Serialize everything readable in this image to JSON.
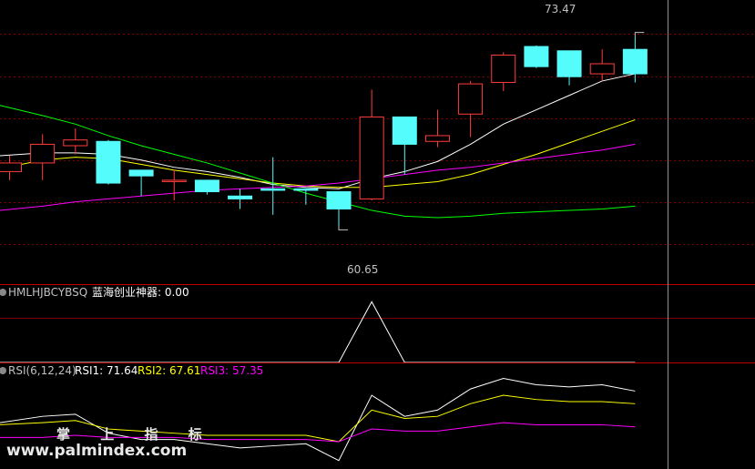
{
  "chart_data": [
    {
      "type": "candlestick",
      "panel": "price",
      "ylim": [
        57,
        76
      ],
      "annotations": {
        "high_label": "73.47",
        "low_label": "60.65"
      },
      "candles": [
        {
          "o": 64.7,
          "h": 65.8,
          "l": 64.1,
          "c": 65.3
        },
        {
          "o": 65.3,
          "h": 67.3,
          "l": 64.1,
          "c": 66.6
        },
        {
          "o": 66.5,
          "h": 67.7,
          "l": 65.9,
          "c": 66.9
        },
        {
          "o": 66.8,
          "h": 66.9,
          "l": 63.8,
          "c": 63.9
        },
        {
          "o": 64.8,
          "h": 64.8,
          "l": 63.0,
          "c": 64.4
        },
        {
          "o": 64.1,
          "h": 64.8,
          "l": 62.7,
          "c": 64.1
        },
        {
          "o": 64.1,
          "h": 64.1,
          "l": 63.1,
          "c": 63.3
        },
        {
          "o": 63.0,
          "h": 63.5,
          "l": 62.1,
          "c": 62.8
        },
        {
          "o": 63.5,
          "h": 65.7,
          "l": 61.7,
          "c": 63.4
        },
        {
          "o": 63.5,
          "h": 63.5,
          "l": 62.4,
          "c": 63.4
        },
        {
          "o": 63.3,
          "h": 63.3,
          "l": 60.65,
          "c": 62.1
        },
        {
          "o": 62.8,
          "h": 70.4,
          "l": 62.7,
          "c": 68.5
        },
        {
          "o": 68.5,
          "h": 68.5,
          "l": 64.5,
          "c": 66.6
        },
        {
          "o": 66.8,
          "h": 69.0,
          "l": 66.4,
          "c": 67.2
        },
        {
          "o": 68.7,
          "h": 71.0,
          "l": 67.1,
          "c": 70.8
        },
        {
          "o": 70.9,
          "h": 73.0,
          "l": 70.3,
          "c": 72.8
        },
        {
          "o": 73.4,
          "h": 73.47,
          "l": 71.9,
          "c": 72.0
        },
        {
          "o": 73.1,
          "h": 73.1,
          "l": 70.7,
          "c": 71.3
        },
        {
          "o": 71.5,
          "h": 73.2,
          "l": 71.0,
          "c": 72.2
        },
        {
          "o": 73.2,
          "h": 74.0,
          "l": 70.9,
          "c": 71.5
        }
      ],
      "series": [
        {
          "color": "#ffffff",
          "values": [
            65.8,
            66.0,
            66.0,
            65.9,
            65.5,
            65.0,
            64.7,
            64.3,
            63.8,
            63.6,
            63.5,
            64.2,
            64.7,
            65.4,
            66.6,
            68.0,
            69.0,
            70.0,
            71.0,
            71.5
          ]
        },
        {
          "color": "#ffff00",
          "values": [
            64.9,
            65.5,
            65.7,
            65.6,
            65.2,
            64.8,
            64.5,
            64.2,
            63.9,
            63.7,
            63.6,
            63.6,
            63.8,
            64.0,
            64.5,
            65.2,
            65.9,
            66.7,
            67.5,
            68.3
          ]
        },
        {
          "color": "#ff00ff",
          "values": [
            62.0,
            62.3,
            62.6,
            62.8,
            63.0,
            63.2,
            63.4,
            63.5,
            63.6,
            63.7,
            63.9,
            64.2,
            64.5,
            64.8,
            65.0,
            65.3,
            65.6,
            65.9,
            66.2,
            66.6
          ]
        },
        {
          "color": "#00ff00",
          "values": [
            69.3,
            68.6,
            68.0,
            67.2,
            66.5,
            65.9,
            65.3,
            64.6,
            63.9,
            63.2,
            62.6,
            62.0,
            61.6,
            61.5,
            61.6,
            61.8,
            61.9,
            62.0,
            62.1,
            62.3
          ]
        }
      ]
    },
    {
      "type": "line",
      "panel": "indicator",
      "name": "HMLHJBCYBSQ",
      "legend": [
        {
          "label": "HMLHJBCYBSQ",
          "color": "#c0c0c0"
        },
        {
          "label": "蓝海创业神器: 0.00",
          "color": "#ffffff"
        }
      ],
      "ylim": [
        0,
        1.2
      ],
      "series": [
        {
          "color": "#ffffff",
          "values": [
            0,
            0,
            0,
            0,
            0,
            0,
            0,
            0,
            0,
            0,
            0,
            1,
            0,
            0,
            0,
            0,
            0,
            0,
            0,
            0
          ]
        }
      ]
    },
    {
      "type": "line",
      "panel": "rsi",
      "name": "RSI(6,12,24)",
      "legend": [
        {
          "label": "RSI(6,12,24)",
          "color": "#c0c0c0"
        },
        {
          "label": "RSI1: 71.64",
          "color": "#ffffff"
        },
        {
          "label": "RSI2: 67.61",
          "color": "#ffff00"
        },
        {
          "label": "RSI3: 57.35",
          "color": "#ff00ff"
        }
      ],
      "ylim": [
        30,
        78
      ],
      "series": [
        {
          "color": "#ffffff",
          "values": [
            52,
            55,
            56,
            47,
            44,
            44,
            42,
            40,
            41,
            42,
            34,
            65,
            55,
            58,
            68,
            73,
            70,
            69,
            70,
            67
          ]
        },
        {
          "color": "#ffff00",
          "values": [
            51,
            52,
            53,
            49,
            48,
            47,
            46,
            46,
            46,
            46,
            43,
            58,
            54,
            55,
            61,
            65,
            63,
            62,
            62,
            61
          ]
        },
        {
          "color": "#ff00ff",
          "values": [
            45,
            45,
            46,
            45,
            45,
            45,
            44,
            44,
            44,
            44,
            43,
            49,
            48,
            48,
            50,
            52,
            51,
            51,
            51,
            50
          ]
        }
      ]
    }
  ],
  "watermark": {
    "line1": "掌 上 指 标",
    "line2": "www.palmindex.com"
  },
  "colors": {
    "up": "#ff3c3c",
    "down": "#54fcfc",
    "grid": "#800000",
    "axis": "#c00000"
  }
}
